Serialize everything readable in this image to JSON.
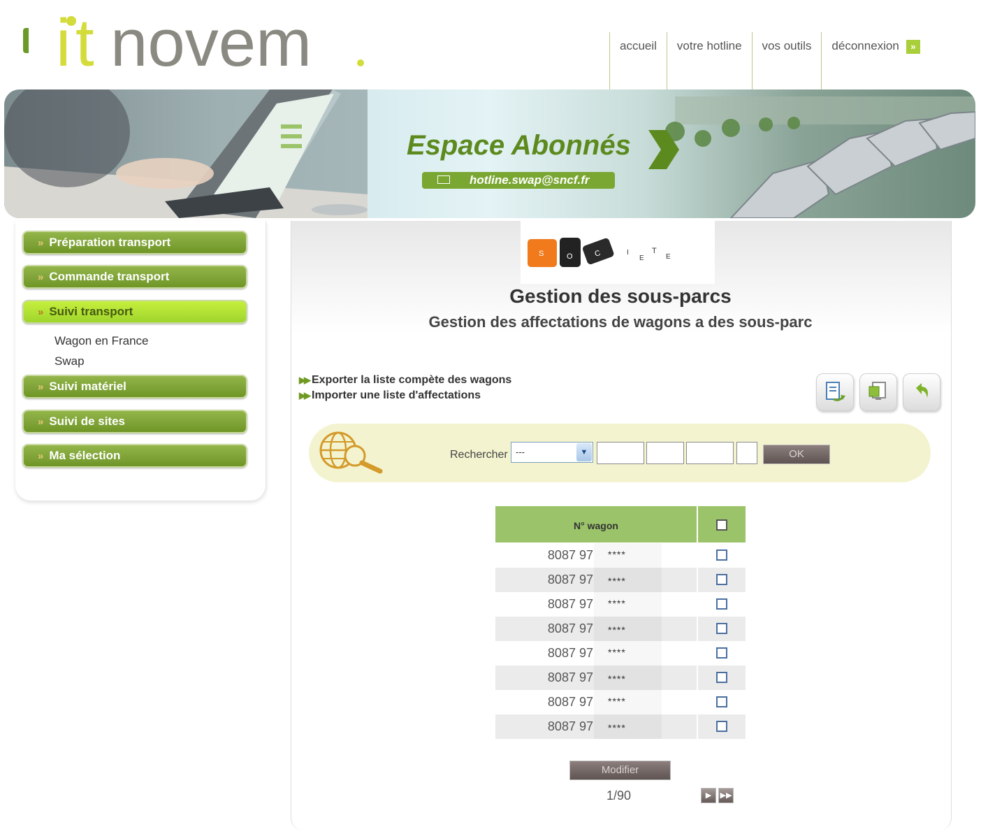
{
  "brand": {
    "logo_text": "itnovem",
    "accent": "#d3dc3a",
    "text_color": "#8a8a82"
  },
  "topnav": {
    "items": [
      {
        "label": "accueil"
      },
      {
        "label": "votre hotline"
      },
      {
        "label": "vos outils"
      },
      {
        "label": "déconnexion"
      }
    ]
  },
  "banner": {
    "title": "Espace Abonnés",
    "email": "hotline.swap@sncf.fr"
  },
  "sidebar": {
    "items": [
      {
        "label": "Préparation transport",
        "active": false
      },
      {
        "label": "Commande transport",
        "active": false
      },
      {
        "label": "Suivi transport",
        "active": true
      },
      {
        "label": "Suivi matériel",
        "active": false
      },
      {
        "label": "Suivi de sites",
        "active": false
      },
      {
        "label": "Ma sélection",
        "active": false
      }
    ],
    "sublinks": [
      "Wagon en France",
      "Swap"
    ]
  },
  "main": {
    "logo_letters": [
      "S",
      "O",
      "C",
      "I",
      "E",
      "T",
      "E"
    ],
    "title": "Gestion des sous-parcs",
    "subtitle": "Gestion des affectations de wagons a des sous-parc",
    "actions": [
      "Exporter la liste compète des wagons",
      "Importer une liste d'affectations"
    ],
    "toolbar_icons": [
      "export-document-icon",
      "import-document-icon",
      "back-arrow-icon"
    ]
  },
  "search": {
    "label": "Rechercher",
    "select_value": "---",
    "ok_label": "OK"
  },
  "table": {
    "header": "N° wagon",
    "rows": [
      {
        "number": "8087 97",
        "mask": "****"
      },
      {
        "number": "8087 97",
        "mask": "****"
      },
      {
        "number": "8087 97",
        "mask": "****"
      },
      {
        "number": "8087 97",
        "mask": "****"
      },
      {
        "number": "8087 97",
        "mask": "****"
      },
      {
        "number": "8087 97",
        "mask": "****"
      },
      {
        "number": "8087 97",
        "mask": "****"
      },
      {
        "number": "8087 97",
        "mask": "****"
      }
    ]
  },
  "footer": {
    "modify_label": "Modifier",
    "page": "1/90"
  }
}
